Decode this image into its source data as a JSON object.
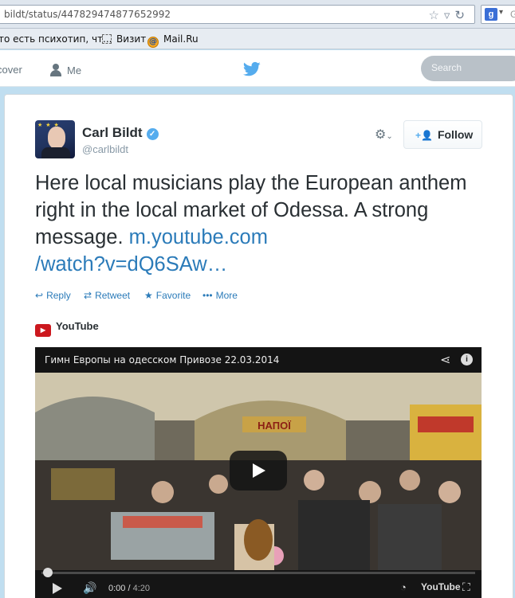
{
  "browser": {
    "url": "bildt/status/447829474877652992",
    "bookmarks": [
      {
        "label": "то есть психотип, чт..."
      },
      {
        "label": "Визит"
      },
      {
        "label": "Mail.Ru"
      }
    ]
  },
  "twitter_nav": {
    "discover": "cover",
    "me": "Me",
    "search_placeholder": "Search"
  },
  "tweet": {
    "name": "Carl Bildt",
    "handle": "@carlbildt",
    "follow_label": "Follow",
    "text": "Here local musicians play the European anthem right in the local market of Odessa. A strong message. ",
    "link_line1": "m.youtube.com",
    "link_line2": "/watch?v=dQ6SAw…",
    "actions": {
      "reply": "Reply",
      "retweet": "Retweet",
      "favorite": "Favorite",
      "more": "More"
    },
    "media_source": "YouTube"
  },
  "video": {
    "title": "Гимн Европы на одесском Привозе 22.03.2014",
    "current_time": "0:00",
    "duration": "4:20",
    "wordmark": "YouTube",
    "sign_text": "НАПОЇ"
  },
  "colors": {
    "link": "#2b7bb9",
    "verified": "#55acee",
    "youtube_red": "#cc181e"
  }
}
